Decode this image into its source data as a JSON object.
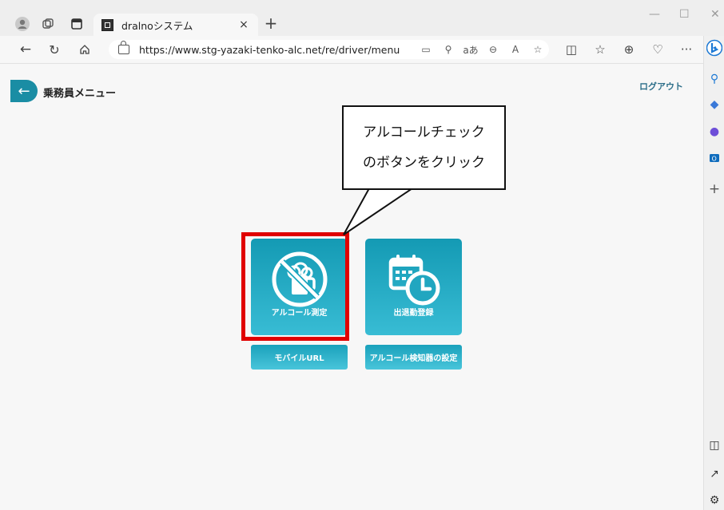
{
  "browser": {
    "tab_title": "dralnoシステム",
    "tab_close": "×",
    "new_tab": "+",
    "url": "https://www.stg-yazaki-tenko-alc.net/re/driver/menu",
    "read_aloud": "aあ",
    "more": "···",
    "win_min": "—",
    "win_max": "☐",
    "win_close": "✕"
  },
  "page": {
    "title": "乗務員メニュー",
    "logout": "ログアウト",
    "tiles": [
      {
        "label": "アルコール測定",
        "icon": "no-alcohol-icon"
      },
      {
        "label": "出退勤登録",
        "icon": "calendar-clock-icon"
      }
    ],
    "buttons": [
      {
        "label": "モバイルURL"
      },
      {
        "label": "アルコール検知器の設定"
      }
    ]
  },
  "annotation": {
    "callout_line1": "アルコールチェック",
    "callout_line2": "のボタンをクリック"
  },
  "colors": {
    "tile_top": "#149ab4",
    "tile_bottom": "#38bcd4",
    "highlight": "#e00000",
    "accent": "#1a8da4"
  }
}
